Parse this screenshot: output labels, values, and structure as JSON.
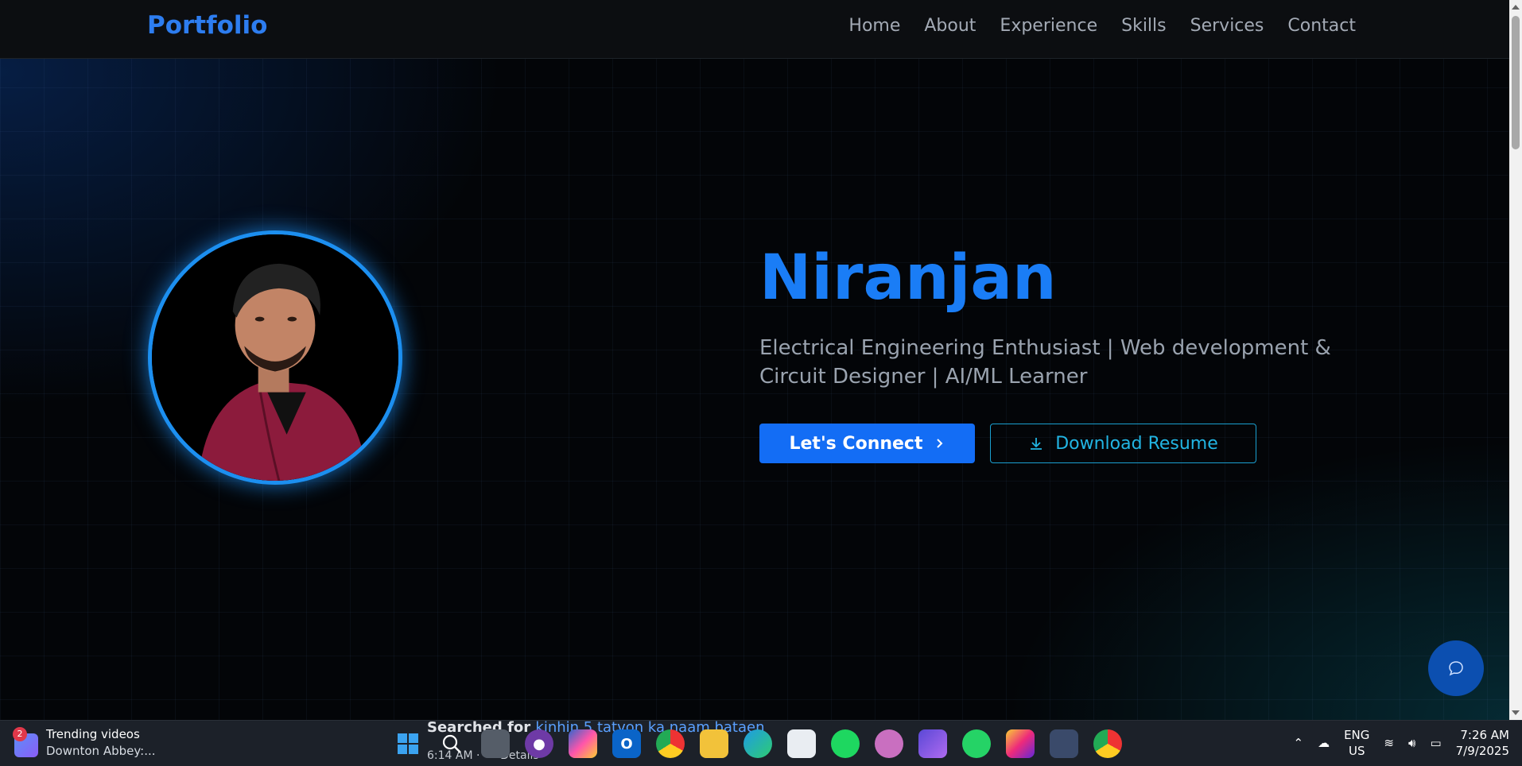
{
  "nav": {
    "brand": "Portfolio",
    "links": [
      "Home",
      "About",
      "Experience",
      "Skills",
      "Services",
      "Contact"
    ]
  },
  "hero": {
    "name": "Niranjan",
    "subtitle": "Electrical Engineering Enthusiast | Web development & Circuit Designer | AI/ML Learner",
    "primary_button": "Let's Connect",
    "secondary_button": "Download Resume"
  },
  "colors": {
    "accent": "#1a7df6",
    "button_primary": "#136df5",
    "button_secondary_border": "#1a9fd0"
  },
  "taskbar": {
    "widget_badge": "2",
    "widget_title": "Trending videos",
    "widget_subtitle": "Downton Abbey:...",
    "search_prefix": "Searched for",
    "search_query": "kinhin 5 tatvon ka naam bataen",
    "search_time": "6:14 AM",
    "search_details": "Details",
    "apps": [
      "windows-start",
      "search",
      "task-view",
      "github",
      "m365-copilot",
      "outlook",
      "chrome",
      "file-explorer",
      "edge",
      "microsoft-store",
      "spotify",
      "obs",
      "clipchamp",
      "whatsapp",
      "instagram",
      "snipping-tool",
      "chrome-v"
    ],
    "lang_top": "ENG",
    "lang_bottom": "US",
    "time": "7:26 AM",
    "date": "7/9/2025"
  }
}
